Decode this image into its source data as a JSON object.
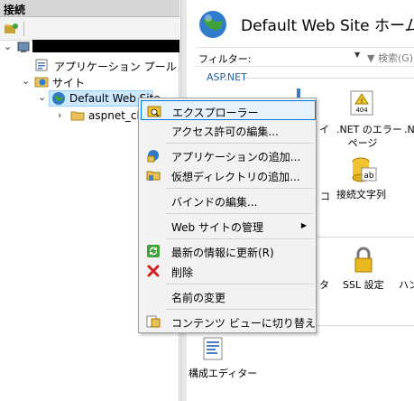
{
  "left_pane": {
    "header": "接続",
    "tree": {
      "app_pools": "アプリケーション プール",
      "sites": "サイト",
      "default_site": "Default Web Site",
      "child_app": "aspnet_clie"
    }
  },
  "main": {
    "title": "Default Web Site ホーム",
    "filter_label": "フィルター:",
    "filter_value": "",
    "search_label": "検索(G)",
    "group_aspnet": "ASP.NET",
    "features": {
      "net_error": ".NET のエラー ページ",
      "net_error_line1": ".NET のエラー",
      "net_error_line2": "ページ",
      "connection_strings": "接続文字列",
      "ssl": "SSL 設定",
      "config_editor": "構成エディター",
      "partial_net": ".N",
      "partial_ai": "イ",
      "partial_ko": "コ",
      "partial_ta": "タ",
      "partial_han": "ハン"
    }
  },
  "context_menu": {
    "items": [
      {
        "label": "エクスプローラー",
        "icon": "explorer-icon"
      },
      {
        "label": "アクセス許可の編集...",
        "icon": ""
      },
      {
        "label": "アプリケーションの追加...",
        "icon": "add-application-icon"
      },
      {
        "label": "仮想ディレクトリの追加...",
        "icon": "add-virtual-directory-icon"
      },
      {
        "label": "バインドの編集...",
        "icon": ""
      },
      {
        "label": "Web サイトの管理",
        "icon": ""
      },
      {
        "label": "最新の情報に更新(R)",
        "icon": "refresh-icon"
      },
      {
        "label": "削除",
        "icon": "delete-icon"
      },
      {
        "label": "名前の変更",
        "icon": ""
      },
      {
        "label": "コンテンツ ビューに切り替え",
        "icon": "content-view-icon"
      }
    ]
  },
  "colors": {
    "highlight_border": "#0078d7",
    "highlight_bg": "#e5f1fb",
    "group_heading": "#1f5fa8",
    "delete_red": "#d21f1f"
  }
}
